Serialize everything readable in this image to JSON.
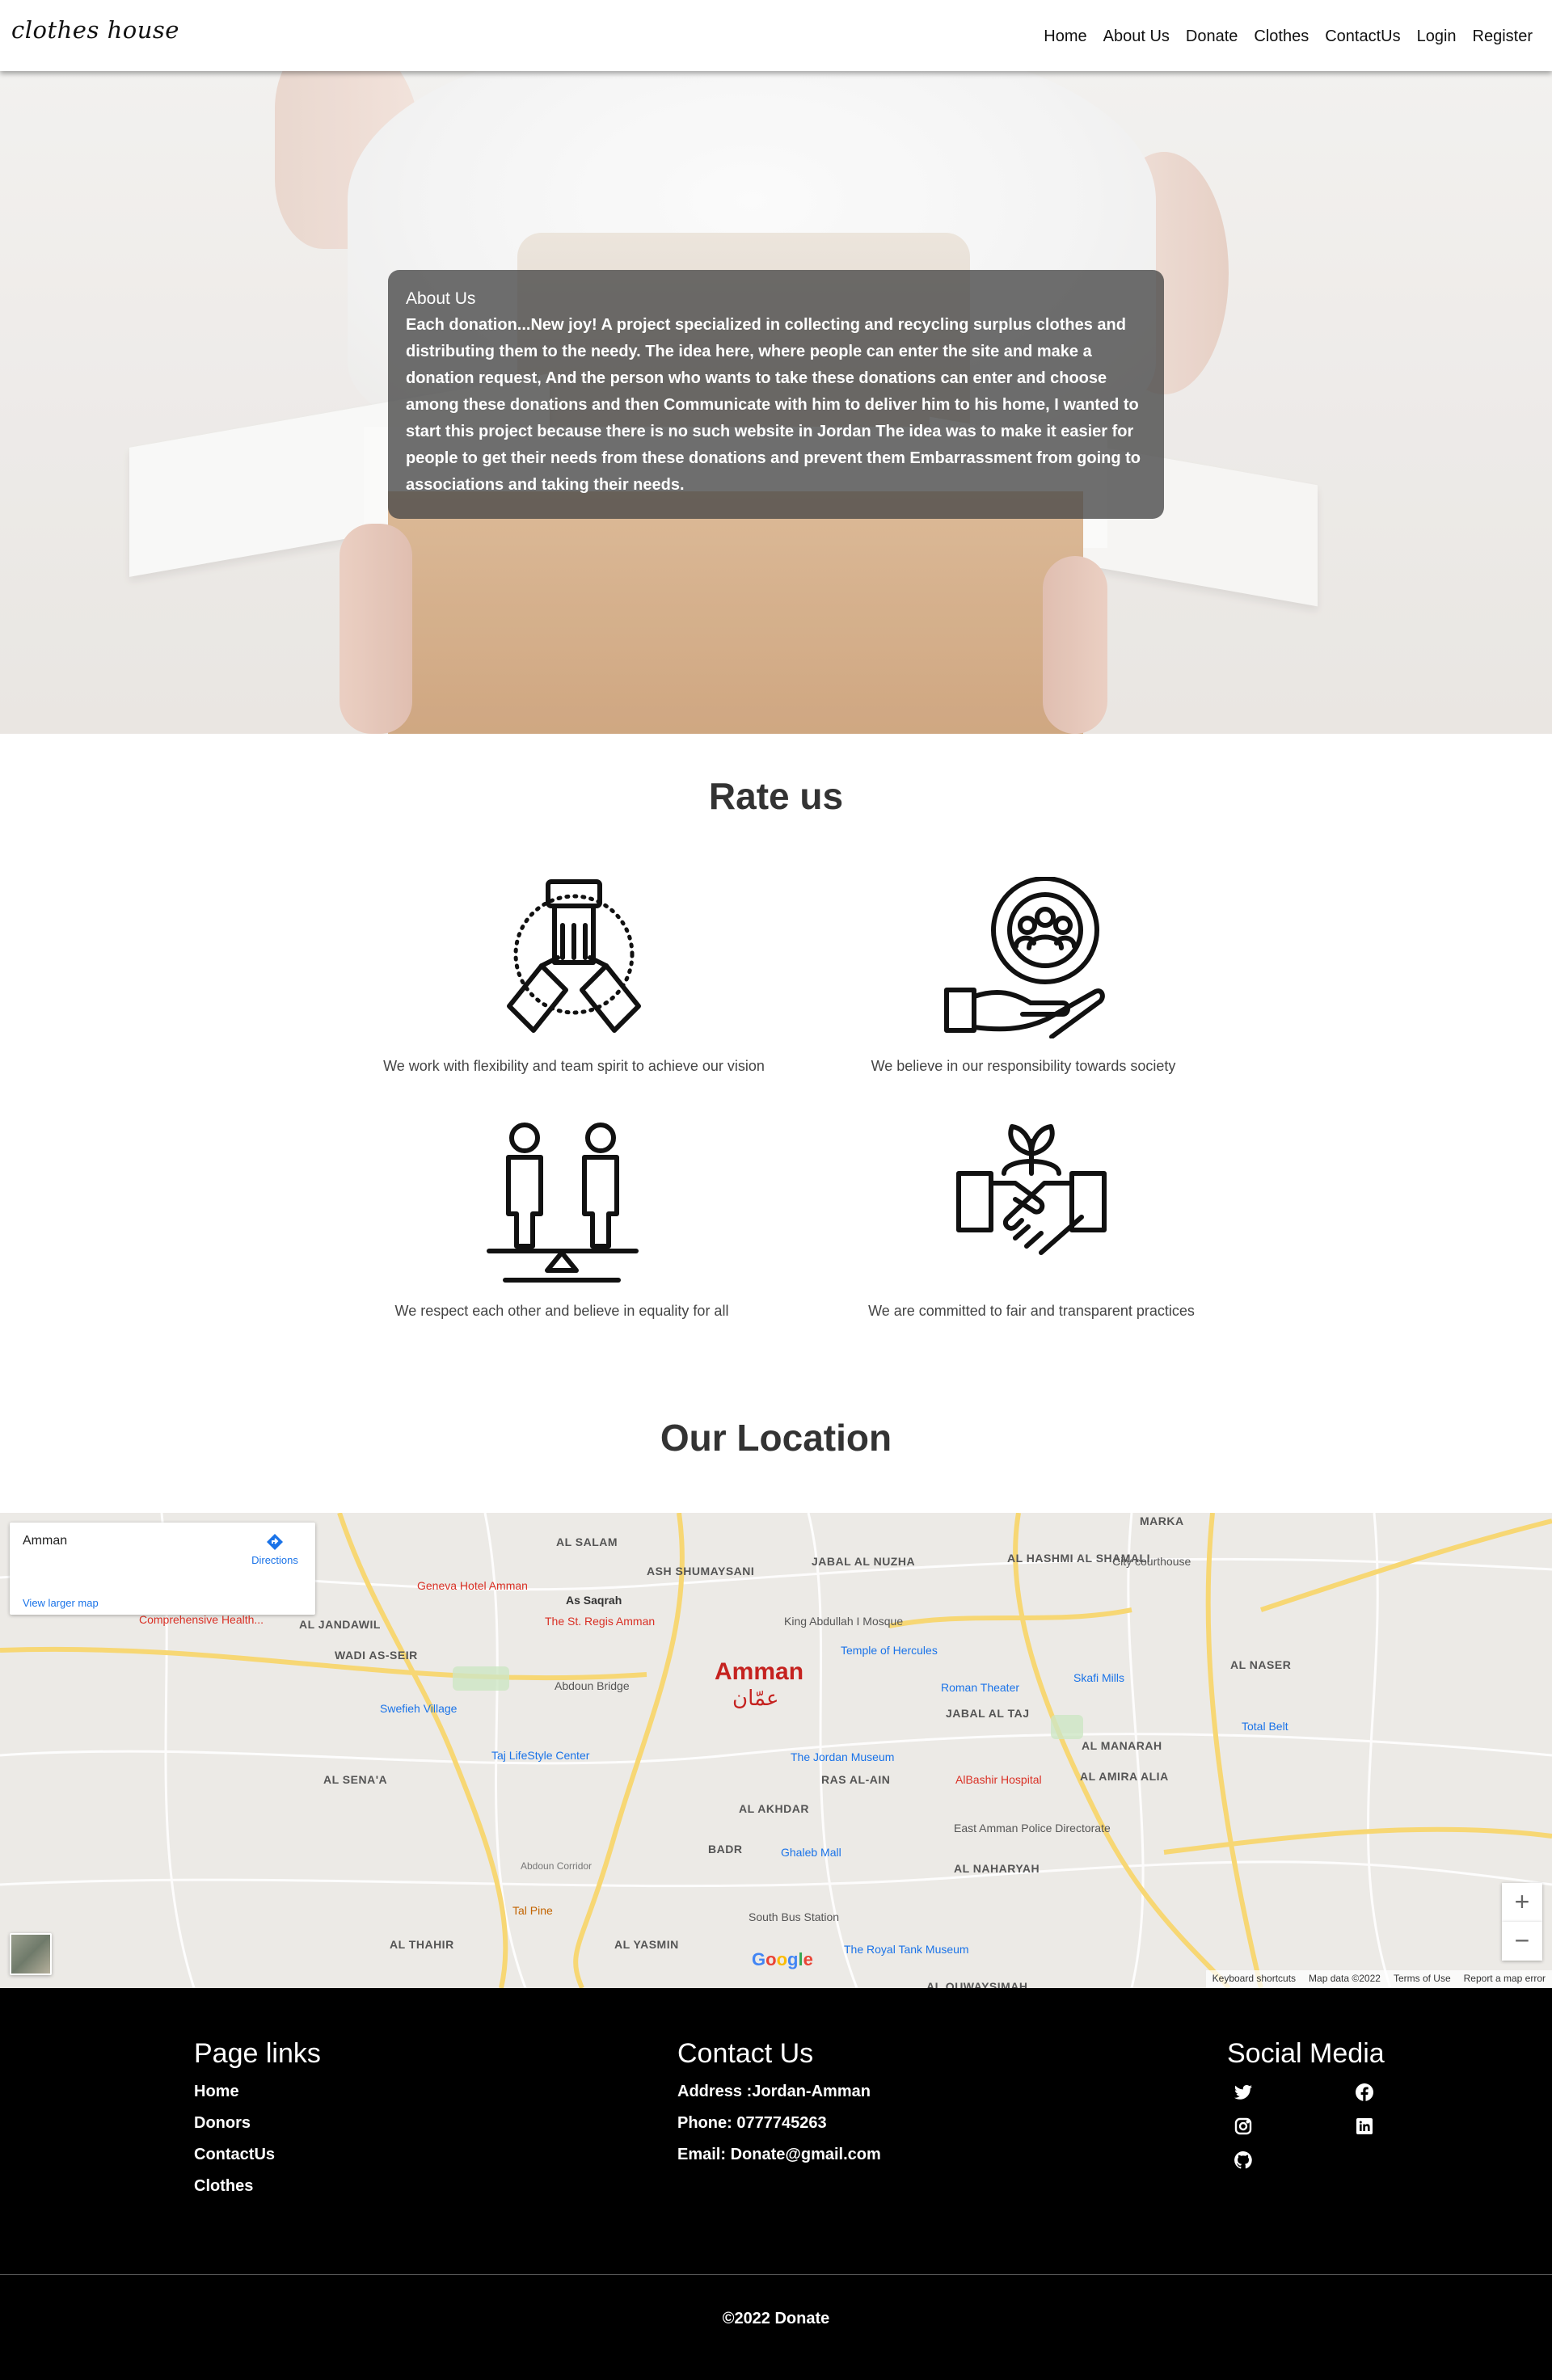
{
  "brand": "clothes house",
  "nav": {
    "items": [
      "Home",
      "About Us",
      "Donate",
      "Clothes",
      "ContactUs",
      "Login",
      "Register"
    ]
  },
  "about": {
    "title": "About Us",
    "text": "Each donation...New joy! A project specialized in collecting and recycling surplus clothes and distributing them to the needy. The idea here, where people can enter the site and make a donation request, And the person who wants to take these donations can enter and choose among these donations and then Communicate with him to deliver him to his home, I wanted to start this project because there is no such website in Jordan The idea was to make it easier for people to get their needs from these donations and prevent them Embarrassment from going to associations and taking their needs."
  },
  "rate": {
    "title": "Rate us",
    "features": [
      {
        "icon": "teamwork-hands-icon",
        "text": "We work with flexibility and team spirit to achieve our vision"
      },
      {
        "icon": "social-responsibility-icon",
        "text": "We believe in our responsibility towards society"
      },
      {
        "icon": "equality-scale-icon",
        "text": "We respect each other and believe in equality for all"
      },
      {
        "icon": "handshake-icon",
        "text": "We are committed to fair and transparent practices"
      }
    ]
  },
  "location": {
    "title": "Our Location",
    "map": {
      "place": "Amman",
      "directions": "Directions",
      "larger_map": "View larger map",
      "city_label": "Amman",
      "city_label_ar": "عمّان",
      "areas": [
        "AL SALAM",
        "ASH SHUMAYSANI",
        "JABAL AL NUZHA",
        "AL HASHMI AL SHAMALI",
        "MARKA",
        "AL JANDAWIL",
        "WADI AS-SEIR",
        "AL NASER",
        "JABAL AL TAJ",
        "AL MANARAH",
        "AL AMIRA ALIA",
        "AL SENA'A",
        "AL AKHDAR",
        "AL NAHARYAH",
        "AL THAHIR",
        "AL YASMIN",
        "BADR",
        "RAS AL-AIN",
        "AL QUWAYSIMAH"
      ],
      "pois": [
        "Geneva Hotel Amman",
        "As Saqrah",
        "The St. Regis Amman",
        "King Abdullah I Mosque",
        "Temple of Hercules",
        "City courthouse",
        "Comprehensive Health...",
        "Abdoun Bridge",
        "Swefieh Village",
        "Taj LifeStyle Center",
        "Roman Theater",
        "Skafi Mills",
        "Total Belt",
        "The Jordan Museum",
        "AlBashir Hospital",
        "East Amman Police Directorate",
        "Ghaleb Mall",
        "Tal Pine",
        "South Bus Station",
        "The Royal Tank Museum",
        "Abdoun Corridor"
      ],
      "footer": [
        "Keyboard shortcuts",
        "Map data ©2022",
        "Terms of Use",
        "Report a map error"
      ]
    }
  },
  "footer": {
    "page_links_title": "Page links",
    "page_links": [
      "Home",
      "Donors",
      "ContactUs",
      "Clothes"
    ],
    "contact_title": "Contact Us",
    "address": "Address :Jordan-Amman",
    "phone": "Phone: 0777745263",
    "email": "Email: Donate@gmail.com",
    "social_title": "Social Media",
    "social_icons": [
      "twitter-icon",
      "facebook-icon",
      "instagram-icon",
      "linkedin-icon",
      "github-icon"
    ],
    "copyright": "©2022 Donate"
  }
}
